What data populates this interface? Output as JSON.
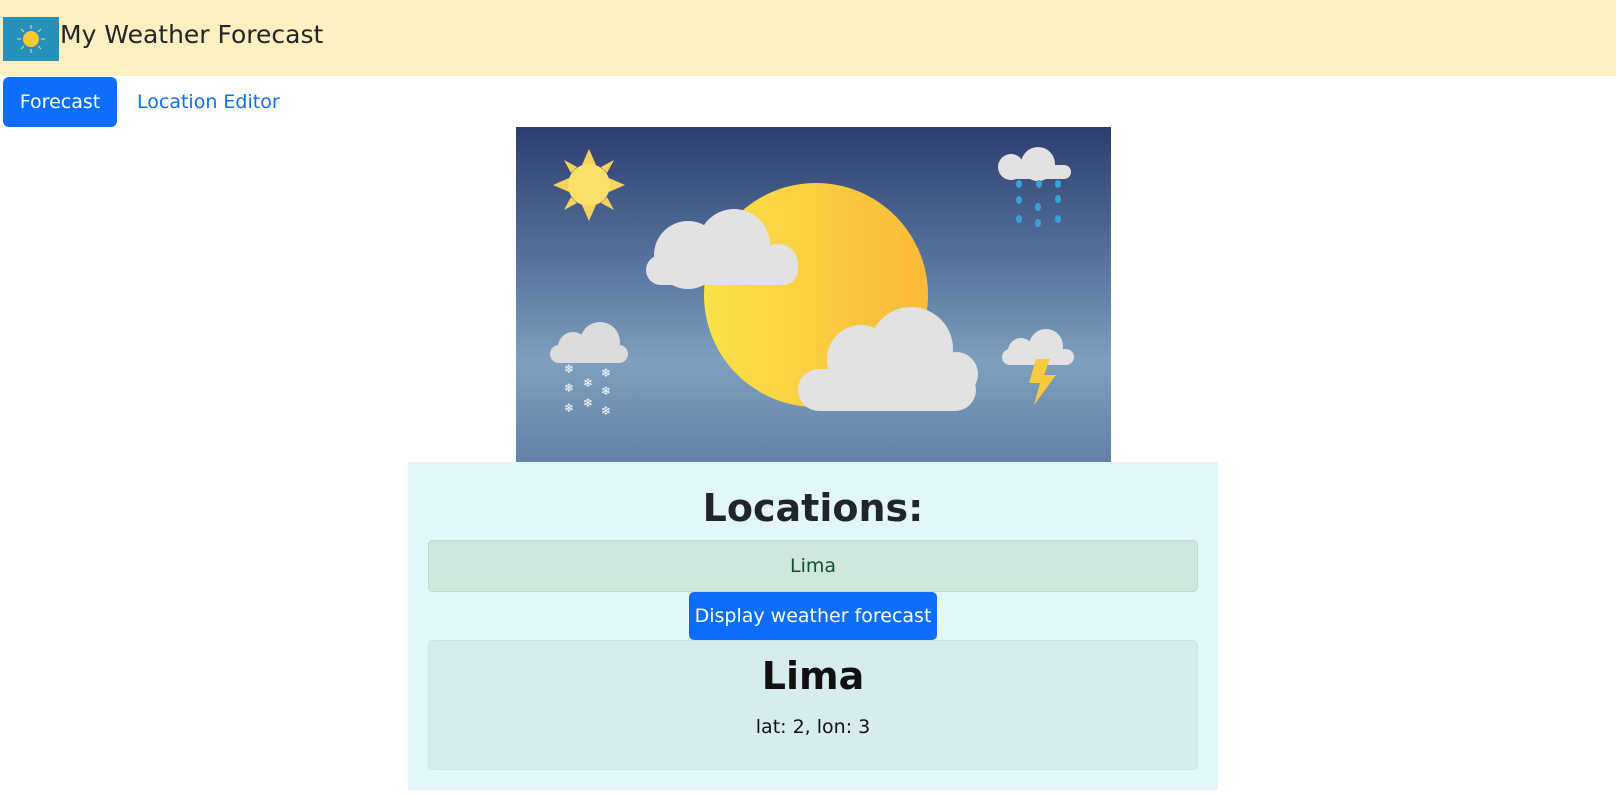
{
  "header": {
    "logo_icon": "sun-icon",
    "title": "My Weather Forecast"
  },
  "nav": {
    "items": [
      {
        "label": "Forecast",
        "active": true
      },
      {
        "label": "Location Editor",
        "active": false
      }
    ]
  },
  "hero": {
    "icons": [
      "sun-icon",
      "rain-cloud-icon",
      "snow-cloud-icon",
      "storm-cloud-icon",
      "cloud-icon"
    ]
  },
  "locations": {
    "heading": "Locations:",
    "selected": "Lima",
    "button_label": "Display weather forecast"
  },
  "forecast": {
    "city": "Lima",
    "coords": "lat: 2, lon: 3"
  },
  "colors": {
    "topbar_bg": "#fff0c1",
    "primary": "#0d6efd",
    "panel_bg": "#e3f7fb",
    "success_bg": "#d1e7dd",
    "card_bg": "#d8ecf0"
  }
}
